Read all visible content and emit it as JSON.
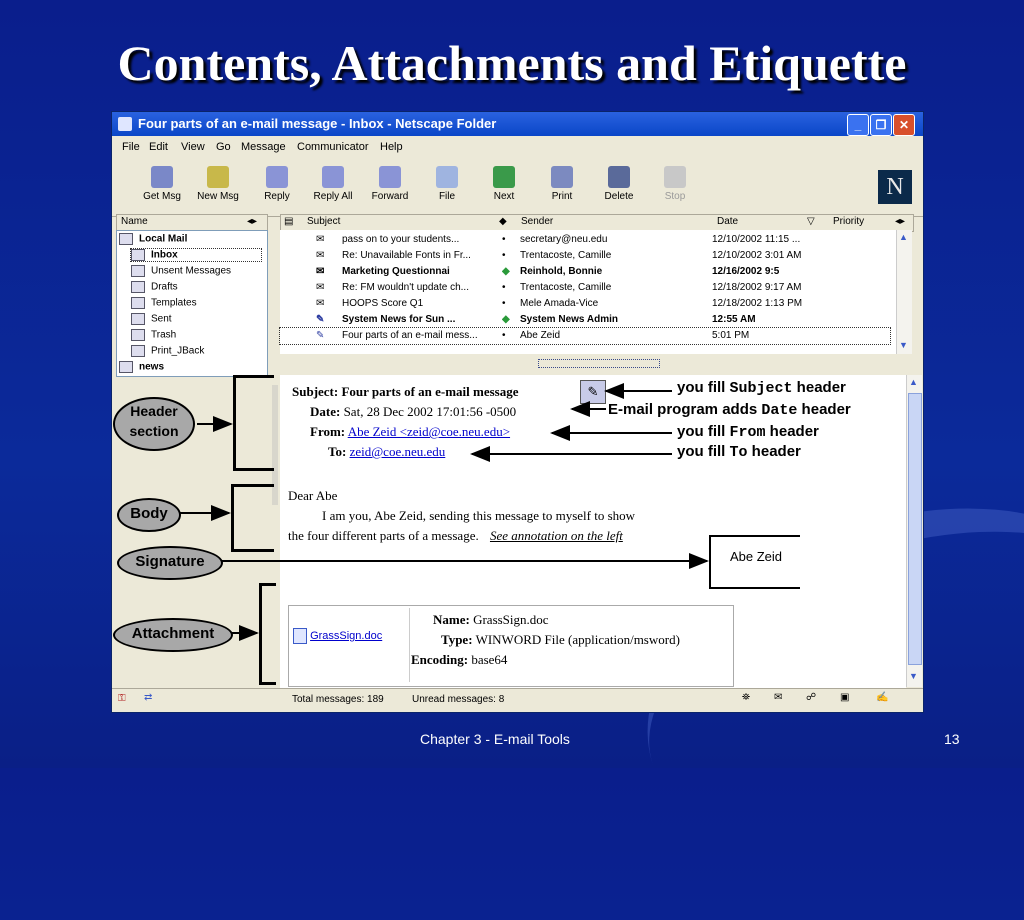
{
  "slide": {
    "title": "Contents, Attachments and Etiquette",
    "footer_center": "Chapter 3 - E-mail Tools",
    "page_number": "13"
  },
  "window": {
    "title": "Four parts of an e-mail message - Inbox - Netscape Folder",
    "menu": [
      "File",
      "Edit",
      "View",
      "Go",
      "Message",
      "Communicator",
      "Help"
    ],
    "toolbar": [
      {
        "label": "Get Msg",
        "icon": "get-msg-icon"
      },
      {
        "label": "New Msg",
        "icon": "new-msg-icon"
      },
      {
        "label": "Reply",
        "icon": "reply-icon"
      },
      {
        "label": "Reply All",
        "icon": "reply-all-icon"
      },
      {
        "label": "Forward",
        "icon": "forward-icon"
      },
      {
        "label": "File",
        "icon": "file-icon"
      },
      {
        "label": "Next",
        "icon": "next-icon"
      },
      {
        "label": "Print",
        "icon": "print-icon"
      },
      {
        "label": "Delete",
        "icon": "delete-icon"
      },
      {
        "label": "Stop",
        "icon": "stop-icon"
      }
    ],
    "logo_letter": "N"
  },
  "folders": {
    "header": "Name",
    "items": [
      {
        "label": "Local Mail",
        "bold": true
      },
      {
        "label": "Inbox",
        "bold": true
      },
      {
        "label": "Unsent Messages",
        "bold": false
      },
      {
        "label": "Drafts",
        "bold": false
      },
      {
        "label": "Templates",
        "bold": false
      },
      {
        "label": "Sent",
        "bold": false
      },
      {
        "label": "Trash",
        "bold": false
      },
      {
        "label": "Print_JBack",
        "bold": false
      },
      {
        "label": "news",
        "bold": true
      }
    ]
  },
  "messages": {
    "headers": {
      "subject": "Subject",
      "sender": "Sender",
      "date": "Date",
      "priority": "Priority"
    },
    "rows": [
      {
        "subject": "pass on to your students...",
        "sender": "secretary@neu.edu",
        "date": "12/10/2002 11:15 ...",
        "bold": false
      },
      {
        "subject": "Re: Unavailable Fonts in Fr...",
        "sender": "Trentacoste, Camille",
        "date": "12/10/2002 3:01 AM",
        "bold": false
      },
      {
        "subject": "Marketing Questionnai",
        "sender": "Reinhold, Bonnie",
        "date": "12/16/2002 9:5",
        "bold": true
      },
      {
        "subject": "Re: FM wouldn't update ch...",
        "sender": "Trentacoste, Camille",
        "date": "12/18/2002 9:17 AM",
        "bold": false
      },
      {
        "subject": "HOOPS Score Q1",
        "sender": "Mele Amada-Vice",
        "date": "12/18/2002 1:13 PM",
        "bold": false
      },
      {
        "subject": "System News for Sun ...",
        "sender": "System News Admin",
        "date": "12:55 AM",
        "bold": true
      },
      {
        "subject": "Four parts of an e-mail mess...",
        "sender": "Abe Zeid",
        "date": "5:01 PM",
        "bold": false
      }
    ]
  },
  "viewer": {
    "subject_label": "Subject:",
    "subject_value": "Four parts of an e-mail message",
    "date_label": "Date:",
    "date_value": "Sat, 28 Dec 2002 17:01:56 -0500",
    "from_label": "From:",
    "from_value": "Abe Zeid <zeid@coe.neu.edu>",
    "to_label": "To:",
    "to_value": "zeid@coe.neu.edu",
    "greeting": "Dear Abe",
    "body_line1": "I am you, Abe Zeid, sending this message to myself to show",
    "body_line2_a": "the four different parts of a message.",
    "body_line2_b": "See annotation on the left",
    "signature": "Abe Zeid",
    "attachment": {
      "file_link": "GrassSign.doc",
      "name_label": "Name:",
      "name_value": "GrassSign.doc",
      "type_label": "Type:",
      "type_value": "WINWORD File (application/msword)",
      "encoding_label": "Encoding:",
      "encoding_value": "base64"
    }
  },
  "callouts": {
    "subject_a": "you fill ",
    "subject_mono": "Subject",
    "subject_b": " header",
    "date_a": "E-mail program adds ",
    "date_mono": "Date",
    "date_b": " header",
    "from_a": "you fill ",
    "from_mono": "From",
    "from_b": " header",
    "to_a": "you fill ",
    "to_mono": "To",
    "to_b": " header"
  },
  "ovals": {
    "header": "Header section",
    "body": "Body",
    "signature": "Signature",
    "attachment": "Attachment"
  },
  "status": {
    "total": "Total messages: 189",
    "unread": "Unread messages: 8"
  }
}
